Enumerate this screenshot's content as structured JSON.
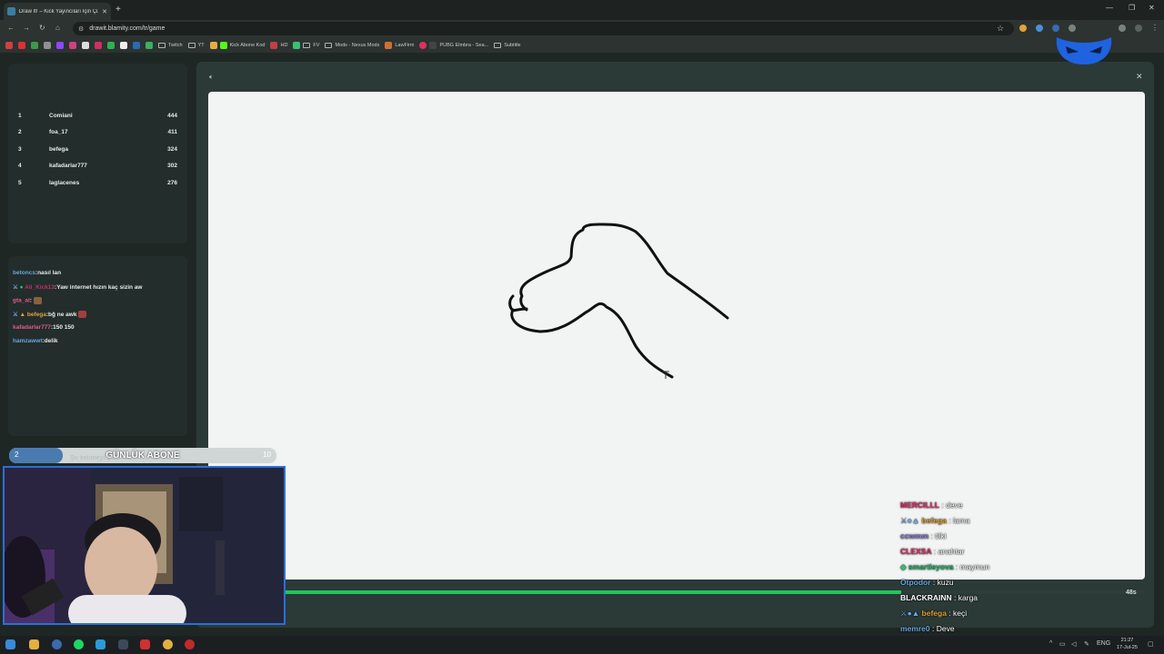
{
  "browser": {
    "tab_title": "Draw It! – Kick Yayıncıları İçin Çiz...",
    "url": "drawit.blamity.com/tr/game",
    "bookmarks": [
      "Twitch",
      "YT",
      "Kick Abone Kod",
      "HD",
      "FV",
      "Mods - Nexus Mods",
      "LawFirm",
      "PUBG Elmbra - Sea...",
      "Subtitle"
    ]
  },
  "leaderboard": [
    {
      "rank": "1",
      "name": "Comiani",
      "score": "444"
    },
    {
      "rank": "2",
      "name": "foa_17",
      "score": "411"
    },
    {
      "rank": "3",
      "name": "befega",
      "score": "324"
    },
    {
      "rank": "4",
      "name": "kafadarlar777",
      "score": "302"
    },
    {
      "rank": "5",
      "name": "laglacenes",
      "score": "276"
    }
  ],
  "chat": [
    {
      "user": "betoncs",
      "msg": ":nasıl lan"
    },
    {
      "user": "Ali_Kick13",
      "msg": ":Yaw internet hızın kaç sizin aw"
    },
    {
      "user": "gta_ai",
      "msg": ":"
    },
    {
      "user": "befega",
      "msg": ":bğ ne awk"
    },
    {
      "user": "kafadarlar777",
      "msg": ":150 150"
    },
    {
      "user": "hamzawwt",
      "msg": ":delik"
    }
  ],
  "subgoal": {
    "label": "GÜNLÜK ABONE",
    "current": "2",
    "target": "10",
    "progress": 0.2,
    "hint": "Şu kelimeyi ça..."
  },
  "game": {
    "timer": "48s",
    "progress": 0.74
  },
  "guesses": [
    {
      "user": "MERCILLL",
      "word": "deve",
      "color": "#e0306e"
    },
    {
      "user": "befega",
      "word": "lama",
      "color": "#e2a23a"
    },
    {
      "user": "ccwmm",
      "word": "tilki",
      "color": "#8b7bd8"
    },
    {
      "user": "CLEXSA",
      "word": "anahtar",
      "color": "#e0306e"
    },
    {
      "user": "smartleyova",
      "word": "maymun",
      "color": "#22b86a"
    },
    {
      "user": "Otpodor",
      "word": "kuzu",
      "color": "#6aa6e0"
    },
    {
      "user": "BLACKRAINN",
      "word": "karga",
      "color": "#ffffff"
    },
    {
      "user": "befega",
      "word": "keçi",
      "color": "#e2a23a"
    },
    {
      "user": "memre0",
      "word": "Deve",
      "color": "#6aa6e0"
    }
  ],
  "clock": {
    "time": "21:27",
    "date": "17-Jul-25",
    "lang": "ENG"
  }
}
